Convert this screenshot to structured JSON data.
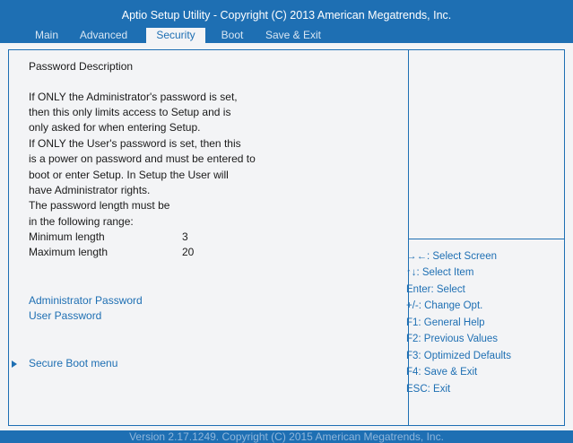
{
  "header": {
    "title": "Aptio Setup Utility - Copyright  (C)  2013 American Megatrends, Inc.",
    "tabs": [
      {
        "label": "Main"
      },
      {
        "label": "Advanced"
      },
      {
        "label": "Security"
      },
      {
        "label": "Boot"
      },
      {
        "label": "Save & Exit"
      }
    ],
    "active_tab": "Security"
  },
  "main": {
    "description_title": "Password Description",
    "description_lines": [
      "If ONLY the Administrator's password is set,",
      "then this only limits access to Setup and is",
      "only asked for when entering Setup.",
      "If ONLY the User's password is set, then this",
      "is a power on password and must be entered to",
      "boot or enter Setup. In Setup the User will",
      "have Administrator rights.",
      "The password length must be",
      "in the following range:"
    ],
    "min_label": "Minimum length",
    "min_value": "3",
    "max_label": "Maximum length",
    "max_value": "20",
    "admin_password": "Administrator Password",
    "user_password": "User Password",
    "secure_boot_menu": "Secure Boot menu"
  },
  "help": {
    "items": [
      "→←: Select Screen",
      "↑↓: Select Item",
      "Enter: Select",
      "+/-: Change Opt.",
      "F1: General Help",
      "F2: Previous Values",
      "F3: Optimized Defaults",
      "F4: Save & Exit",
      "ESC: Exit"
    ]
  },
  "footer": {
    "version": "Version 2.17.1249. Copyright  (C)  2015 American Megatrends, Inc."
  },
  "colors": {
    "accent": "#1e6fb3",
    "background": "#f3f4f6",
    "text": "#1a1a1a"
  }
}
